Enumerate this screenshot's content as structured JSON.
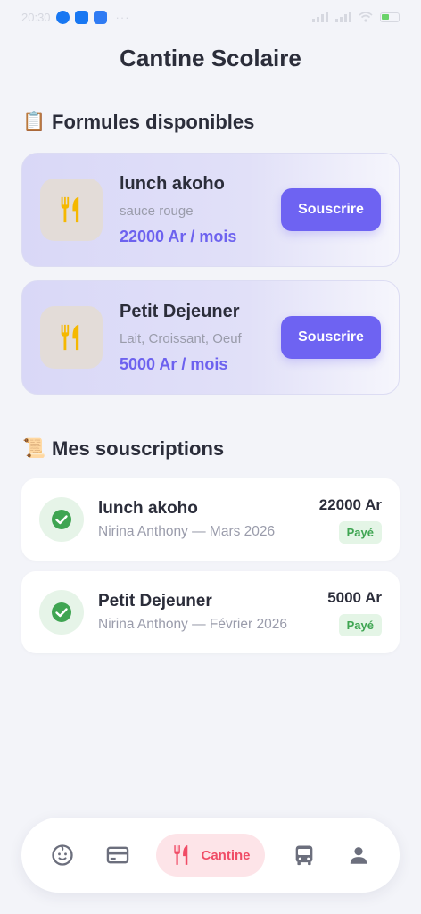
{
  "status_bar": {
    "time": "20:30",
    "dots": "···"
  },
  "app": {
    "title": "Cantine Scolaire"
  },
  "formules": {
    "emoji": "📋",
    "title": "Formules disponibles",
    "items": [
      {
        "name": "lunch akoho",
        "description": "sauce rouge",
        "price": "22000 Ar / mois",
        "button": "Souscrire"
      },
      {
        "name": "Petit Dejeuner",
        "description": "Lait, Croissant, Oeuf",
        "price": "5000 Ar / mois",
        "button": "Souscrire"
      }
    ]
  },
  "souscriptions": {
    "emoji": "📜",
    "title": "Mes souscriptions",
    "items": [
      {
        "name": "lunch akoho",
        "meta": "Nirina Anthony — Mars 2026",
        "amount": "22000 Ar",
        "status": "Payé"
      },
      {
        "name": "Petit Dejeuner",
        "meta": "Nirina Anthony — Février 2026",
        "amount": "5000 Ar",
        "status": "Payé"
      }
    ]
  },
  "nav": {
    "items": [
      {
        "icon": "child-face-icon"
      },
      {
        "icon": "credit-card-icon"
      },
      {
        "icon": "fork-knife-icon",
        "label": "Cantine",
        "active": true
      },
      {
        "icon": "bus-icon"
      },
      {
        "icon": "user-icon"
      }
    ]
  },
  "colors": {
    "accent": "#6e63f2",
    "price": "#6d62ef",
    "paid": "#3fa552",
    "active_nav": "#f04c66",
    "food_icon": "#f5b800"
  }
}
